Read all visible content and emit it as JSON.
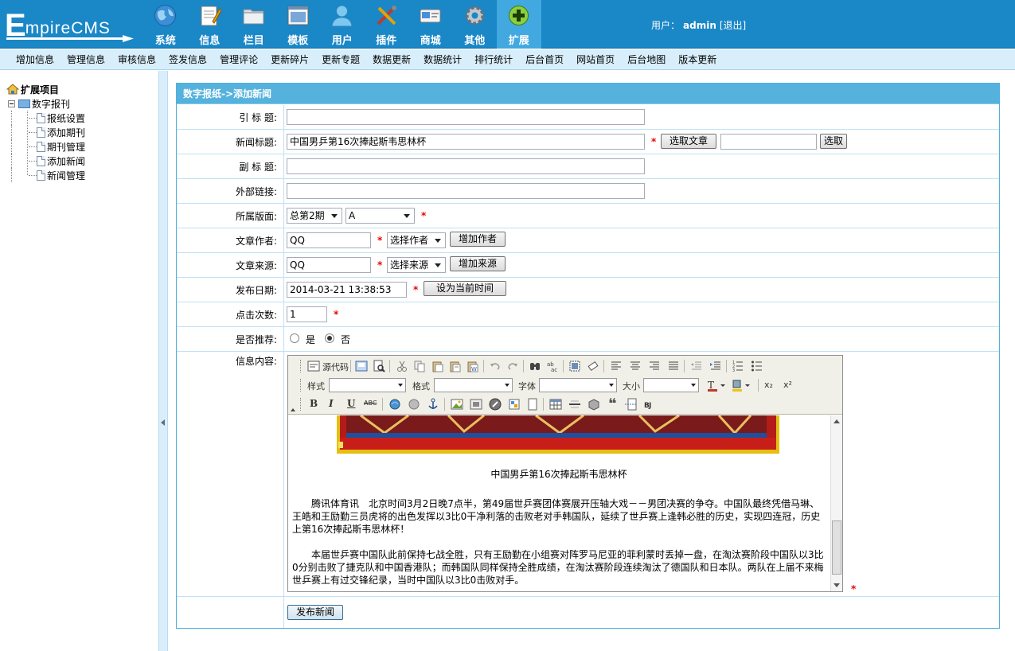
{
  "header": {
    "logo_big": "E",
    "logo_rest": "mpireCMS",
    "user_label": "用户：",
    "username": "admin",
    "logout": "[退出]"
  },
  "nav": [
    {
      "label": "系统",
      "icon": "globe-icon"
    },
    {
      "label": "信息",
      "icon": "notepad-icon"
    },
    {
      "label": "栏目",
      "icon": "folder-icon"
    },
    {
      "label": "模板",
      "icon": "template-window-icon"
    },
    {
      "label": "用户",
      "icon": "user-icon"
    },
    {
      "label": "插件",
      "icon": "tools-icon"
    },
    {
      "label": "商城",
      "icon": "card-icon"
    },
    {
      "label": "其他",
      "icon": "gear-icon"
    },
    {
      "label": "扩展",
      "icon": "plus-icon"
    }
  ],
  "subnav": [
    "增加信息",
    "管理信息",
    "审核信息",
    "签发信息",
    "管理评论",
    "更新碎片",
    "更新专题",
    "数据更新",
    "数据统计",
    "排行统计",
    "后台首页",
    "网站首页",
    "后台地图",
    "版本更新"
  ],
  "tree": {
    "root": "扩展项目",
    "group": "数字报刊",
    "items": [
      "报纸设置",
      "添加期刊",
      "期刊管理",
      "添加新闻",
      "新闻管理"
    ]
  },
  "form": {
    "title": "数字报纸->添加新闻",
    "labels": {
      "yinbiaoti": "引 标 题:",
      "xinwenbiaoti": "新闻标题:",
      "fubiaoti": "副 标 题:",
      "waibulianjie": "外部链接:",
      "suoshubanmian": "所属版面:",
      "wenzhangzuozhe": "文章作者:",
      "wenzhanglaiyuan": "文章来源:",
      "faburiqi": "发布日期:",
      "dianjicishu": "点击次数:",
      "shifoutuijian": "是否推荐:",
      "xinxineirong": "信息内容:"
    },
    "news_title": "中国男乒第16次捧起斯韦思林杯",
    "btn_select_article": "选取文章",
    "btn_select": "选取",
    "issue_select": "总第2期",
    "page_select": "A",
    "author": "QQ",
    "author_select": "选择作者",
    "btn_add_author": "增加作者",
    "source": "QQ",
    "source_select": "选择来源",
    "btn_add_source": "增加来源",
    "date": "2014-03-21 13:38:53",
    "btn_now": "设为当前时间",
    "clicks": "1",
    "recommend_yes": "是",
    "recommend_no": "否",
    "required": "*",
    "btn_publish": "发布新闻"
  },
  "editor": {
    "source_label": "源代码",
    "style_label": "样式",
    "format_label": "格式",
    "font_label": "字体",
    "size_label": "大小",
    "bold": "B",
    "italic": "I",
    "underline": "U",
    "strike": "ABC",
    "sub": "x₂",
    "sup": "x²",
    "caption": "中国男乒第16次捧起斯韦思林杯",
    "para1": "　　腾讯体育讯　北京时间3月2日晚7点半，第49届世乒赛团体赛展开压轴大戏－－男团决赛的争夺。中国队最终凭借马琳、王皓和王励勤三员虎将的出色发挥以3比0干净利落的击败老对手韩国队，延续了世乒赛上逢韩必胜的历史，实现四连冠，历史上第16次捧起斯韦思林杯！",
    "para2": "　　本届世乒赛中国队此前保持七战全胜，只有王励勤在小组赛对阵罗马尼亚的菲利蒙时丢掉一盘，在淘汰赛阶段中国队以3比0分别击败了捷克队和中国香港队；而韩国队同样保持全胜成绩，在淘汰赛阶段连续淘汰了德国队和日本队。两队在上届不来梅世乒赛上有过交锋纪录，当时中国队以3比0击败对手。"
  },
  "colors": {
    "header_bg": "#1a87c7",
    "panel_title_bg": "#55b2dc",
    "required_red": "#e00000"
  }
}
